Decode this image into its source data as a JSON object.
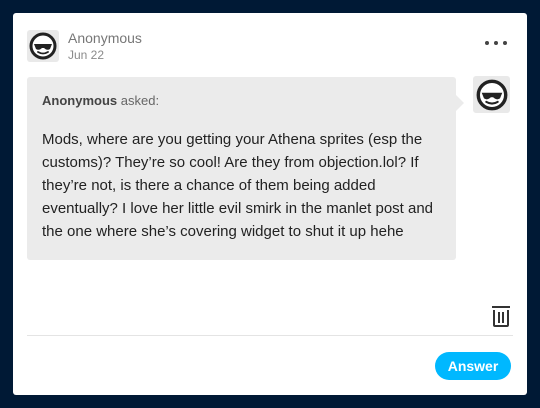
{
  "header": {
    "author": "Anonymous",
    "date": "Jun 22",
    "avatar_icon": "anonymous-sunglasses-icon",
    "more_icon": "ellipsis-icon"
  },
  "ask": {
    "asker_name": "Anonymous",
    "asked_label": "asked:",
    "question": "Mods, where are you getting your Athena sprites (esp the customs)? They’re so cool! Are they from objection.lol? If they’re not, is there a chance of them being added eventually? I love her little evil smirk in the manlet post and the one where she’s covering widget to shut it up hehe",
    "bubble_color": "#ebebeb"
  },
  "footer": {
    "delete_icon": "trash-icon",
    "answer_label": "Answer",
    "answer_color": "#00b8ff"
  },
  "colors": {
    "page_background": "#001935",
    "card_background": "#ffffff"
  }
}
